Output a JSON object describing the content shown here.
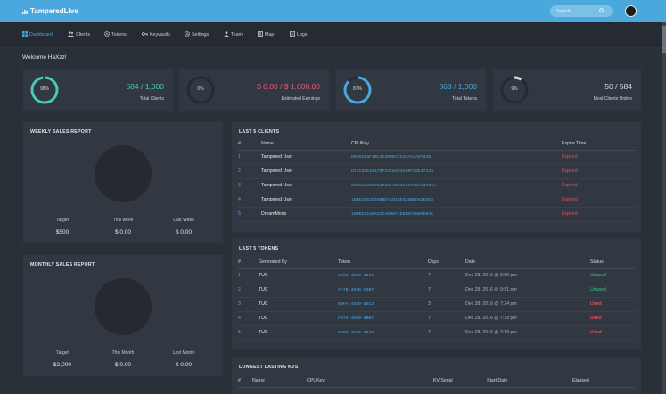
{
  "app": {
    "title": "TamperedLive"
  },
  "search": {
    "placeholder": "Search..."
  },
  "nav": [
    {
      "label": "Dashboard",
      "icon": "dashboard-icon"
    },
    {
      "label": "Clients",
      "icon": "users-icon"
    },
    {
      "label": "Tokens",
      "icon": "gear-icon"
    },
    {
      "label": "Keyvaults",
      "icon": "key-icon"
    },
    {
      "label": "Settings",
      "icon": "gear-icon"
    },
    {
      "label": "Team",
      "icon": "user-icon"
    },
    {
      "label": "Map",
      "icon": "map-icon"
    },
    {
      "label": "Logs",
      "icon": "log-icon"
    }
  ],
  "welcome": "Welcome HaXzz!",
  "stats": [
    {
      "percent": 98,
      "pct_label": "98%",
      "value": "584 / 1,000",
      "label": "Total Clients",
      "color": "#4ac8b8"
    },
    {
      "percent": 0,
      "pct_label": "0%",
      "value": "$ 0.00 / $ 1,000.00",
      "label": "Estimated Earnings",
      "color": "#e65a7d"
    },
    {
      "percent": 87,
      "pct_label": "87%",
      "value": "868 / 1,000",
      "label": "Total Tokens",
      "color": "#4aa8dc"
    },
    {
      "percent": 9,
      "pct_label": "9%",
      "value": "50 / 584",
      "label": "Most Clients Online",
      "color": "#d8dde3"
    }
  ],
  "weekly": {
    "title": "WEEKLY SALES REPORT",
    "cols": [
      {
        "label": "Target",
        "value": "$500"
      },
      {
        "label": "This week",
        "value": "$ 0.00"
      },
      {
        "label": "Last Week",
        "value": "$ 0.00"
      }
    ]
  },
  "monthly": {
    "title": "MONTHLY SALES REPORT",
    "cols": [
      {
        "label": "Target",
        "value": "$2,000"
      },
      {
        "label": "This Month",
        "value": "$ 0.00"
      },
      {
        "label": "Last Month",
        "value": "$ 0.00"
      }
    ]
  },
  "clients": {
    "title": "LAST 5 CLIENTS",
    "headers": [
      "#",
      "Name",
      "CPUKey",
      "Expire Time"
    ],
    "rows": [
      [
        "1",
        "Tampered User",
        "D065558F2BC31390B72C2CA13A6744D",
        "Expired"
      ],
      [
        "2",
        "Tampered User",
        "D72C85E16475F34284F3A69F13E47245",
        "Expired"
      ],
      [
        "3",
        "Tampered User",
        "03b0a6a6275a08314290a657c0ed479ac",
        "Expired"
      ],
      [
        "4",
        "Tampered User",
        "1DDD1B82D886BD7AD15D425BBD83D4C8",
        "Expired"
      ],
      [
        "5",
        "DreamMods",
        "10DDC8150ACCCAEB071EEBEF0B8FE04C",
        "Expired"
      ]
    ]
  },
  "tokens": {
    "title": "LAST 5 TOKENS",
    "headers": [
      "#",
      "Generated By",
      "Token",
      "Days",
      "Date",
      "Status"
    ],
    "rows": [
      [
        "1",
        "TUC",
        "5868-45HB-8D31",
        "7",
        "Dec 28, 2016 @ 9:59 pm",
        "Unused"
      ],
      [
        "2",
        "TUC",
        "AF7B-493B-93B7",
        "7",
        "Dec 28, 2016 @ 9:51 pm",
        "Unused"
      ],
      [
        "3",
        "TUC",
        "50FA-4349-85C3",
        "3",
        "Dec 28, 2016 @ 7:24 pm",
        "Used"
      ],
      [
        "4",
        "TUC",
        "FB75-4598-8BB7",
        "7",
        "Dec 28, 2016 @ 7:19 pm",
        "Used"
      ],
      [
        "5",
        "TUC",
        "8808-4642-8243",
        "7",
        "Dec 28, 2016 @ 7:19 pm",
        "Used"
      ]
    ]
  },
  "kvs": {
    "title": "LONGEST LASTING KVS",
    "headers": [
      "#",
      "Name",
      "CPUKey",
      "KV Serial",
      "Start Date",
      "Elapsed"
    ]
  }
}
